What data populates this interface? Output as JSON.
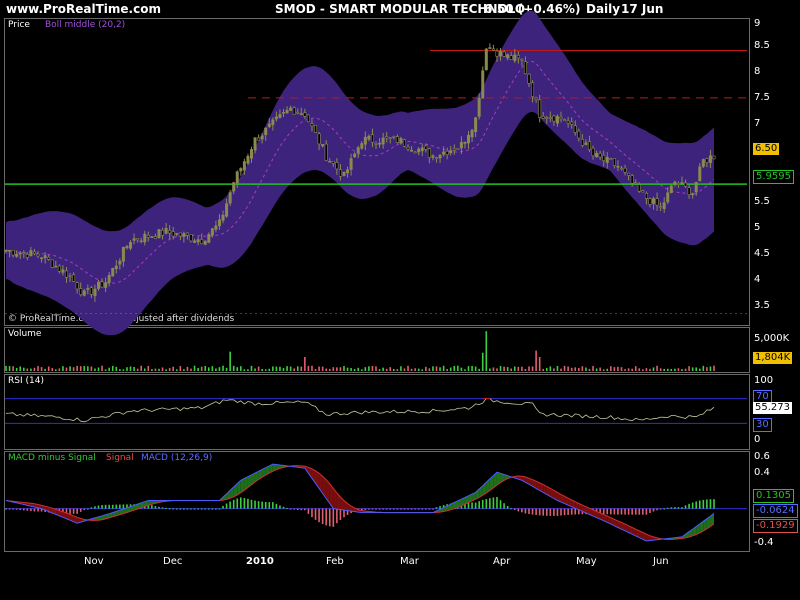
{
  "header": {
    "site": "www.ProRealTime.com",
    "ticker": "SMOD - SMART MODULAR TECHNOLO",
    "price": "6.50 (+0.46%)",
    "period": "Daily",
    "date": "17 Jun"
  },
  "colors": {
    "band": "#3d237c",
    "bollMiddle": "#a83cc8",
    "green": "#22c322",
    "red": "#c01818",
    "candleUp": "#8a8a50",
    "volUp": "#3ecf3e",
    "volDown": "#e06070",
    "rsiLine": "#c8c8a0",
    "macdUp": "#1e6e1e",
    "macdDown": "#7a0e0e",
    "bluePanel": "#3030d0"
  },
  "panels": {
    "price": {
      "label_price": "Price",
      "label_boll": "Boll middle (20,2)",
      "footer": "© ProRealTime.com  Data adjusted after dividends",
      "ticks": [
        "9",
        "8.5",
        "8",
        "7.5",
        "7",
        "6.5",
        "6",
        "5.5",
        "5",
        "4.5",
        "4",
        "3.5"
      ],
      "last_price": "6.50",
      "support_value": "5.9595"
    },
    "volume": {
      "label": "Volume",
      "ticks": [
        "5,000K",
        "0"
      ],
      "last_value": "1,804K"
    },
    "rsi": {
      "label": "RSI (14)",
      "ticks": [
        "100",
        "70",
        "30",
        "0"
      ],
      "last_value": "55.273"
    },
    "macd": {
      "label_a": "MACD minus Signal",
      "label_b": "Signal",
      "label_c": "MACD (12,26,9)",
      "ticks": [
        "0.6",
        "0.4",
        "0.2",
        "0",
        "-0.2",
        "-0.4"
      ],
      "hist_value": "0.1305",
      "macd_value": "-0.0624",
      "signal_value": "-0.1929"
    }
  },
  "x_axis": {
    "months": [
      "Nov",
      "Dec",
      "2010",
      "Feb",
      "Mar",
      "Apr",
      "May",
      "Jun"
    ]
  },
  "chart_data": [
    {
      "type": "candlestick",
      "title": "SMOD - SMART MODULAR TECHNOLO",
      "x_range": [
        "Oct",
        "17 Jun"
      ],
      "ylim": [
        3.3,
        9.1
      ],
      "close_anchors": [
        [
          0,
          4.7
        ],
        [
          10,
          4.6
        ],
        [
          18,
          4.2
        ],
        [
          22,
          3.85
        ],
        [
          28,
          4.1
        ],
        [
          35,
          4.9
        ],
        [
          45,
          5.05
        ],
        [
          55,
          4.9
        ],
        [
          60,
          5.2
        ],
        [
          64,
          6.0
        ],
        [
          70,
          6.8
        ],
        [
          80,
          7.4
        ],
        [
          84,
          7.3
        ],
        [
          90,
          6.5
        ],
        [
          95,
          6.1
        ],
        [
          100,
          6.8
        ],
        [
          110,
          6.8
        ],
        [
          120,
          6.5
        ],
        [
          128,
          6.7
        ],
        [
          132,
          7.2
        ],
        [
          135,
          8.6
        ],
        [
          140,
          8.4
        ],
        [
          145,
          8.3
        ],
        [
          150,
          7.3
        ],
        [
          157,
          7.2
        ],
        [
          165,
          6.5
        ],
        [
          172,
          6.3
        ],
        [
          178,
          5.8
        ],
        [
          184,
          5.5
        ],
        [
          188,
          6.0
        ],
        [
          193,
          5.8
        ],
        [
          196,
          6.4
        ],
        [
          199,
          6.5
        ]
      ],
      "bollinger_width": 0.9,
      "resistance_lines": [
        8.5,
        7.6
      ],
      "support_line": 5.9595,
      "volume_spikes": [
        [
          63,
          1.8
        ],
        [
          84,
          1.3
        ],
        [
          134,
          1.7
        ],
        [
          135,
          3.7
        ],
        [
          149,
          1.9
        ],
        [
          150,
          1.3
        ],
        [
          199,
          0.5
        ]
      ],
      "rsi_anchors": [
        [
          0,
          45
        ],
        [
          15,
          40
        ],
        [
          22,
          35
        ],
        [
          35,
          50
        ],
        [
          55,
          55
        ],
        [
          62,
          68
        ],
        [
          70,
          62
        ],
        [
          84,
          64
        ],
        [
          90,
          45
        ],
        [
          100,
          48
        ],
        [
          120,
          50
        ],
        [
          130,
          55
        ],
        [
          135,
          68
        ],
        [
          148,
          60
        ],
        [
          150,
          45
        ],
        [
          170,
          40
        ],
        [
          178,
          35
        ],
        [
          186,
          42
        ],
        [
          194,
          40
        ],
        [
          199,
          55
        ]
      ],
      "rsi_levels": [
        70,
        30
      ],
      "macd_anchors": [
        [
          0,
          0.1
        ],
        [
          10,
          0.0
        ],
        [
          20,
          -0.18
        ],
        [
          30,
          -0.05
        ],
        [
          40,
          0.1
        ],
        [
          60,
          0.1
        ],
        [
          66,
          0.35
        ],
        [
          75,
          0.55
        ],
        [
          84,
          0.5
        ],
        [
          92,
          0.0
        ],
        [
          100,
          -0.05
        ],
        [
          120,
          -0.05
        ],
        [
          132,
          0.2
        ],
        [
          138,
          0.45
        ],
        [
          145,
          0.35
        ],
        [
          155,
          0.1
        ],
        [
          168,
          -0.15
        ],
        [
          180,
          -0.4
        ],
        [
          190,
          -0.35
        ],
        [
          199,
          -0.06
        ]
      ]
    }
  ]
}
